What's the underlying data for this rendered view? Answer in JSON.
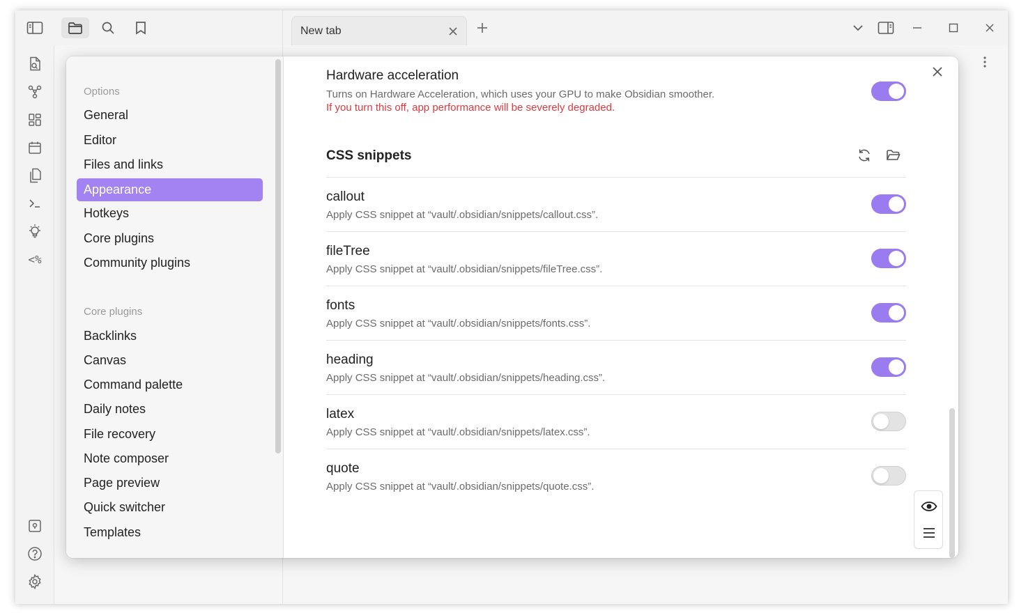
{
  "tab": {
    "title": "New tab"
  },
  "settings_nav": {
    "sections": [
      {
        "heading": "Options",
        "items": [
          "General",
          "Editor",
          "Files and links",
          "Appearance",
          "Hotkeys",
          "Core plugins",
          "Community plugins"
        ]
      },
      {
        "heading": "Core plugins",
        "items": [
          "Backlinks",
          "Canvas",
          "Command palette",
          "Daily notes",
          "File recovery",
          "Note composer",
          "Page preview",
          "Quick switcher",
          "Templates"
        ]
      }
    ],
    "active": "Appearance"
  },
  "hardware": {
    "title": "Hardware acceleration",
    "desc": "Turns on Hardware Acceleration, which uses your GPU to make Obsidian smoother.",
    "warning": "If you turn this off, app performance will be severely degraded.",
    "enabled": true
  },
  "css_snippets": {
    "title": "CSS snippets",
    "items": [
      {
        "name": "callout",
        "desc": "Apply CSS snippet at “vault/.obsidian/snippets/callout.css”.",
        "enabled": true
      },
      {
        "name": "fileTree",
        "desc": "Apply CSS snippet at “vault/.obsidian/snippets/fileTree.css”.",
        "enabled": true
      },
      {
        "name": "fonts",
        "desc": "Apply CSS snippet at “vault/.obsidian/snippets/fonts.css”.",
        "enabled": true
      },
      {
        "name": "heading",
        "desc": "Apply CSS snippet at “vault/.obsidian/snippets/heading.css”.",
        "enabled": true
      },
      {
        "name": "latex",
        "desc": "Apply CSS snippet at “vault/.obsidian/snippets/latex.css”.",
        "enabled": false
      },
      {
        "name": "quote",
        "desc": "Apply CSS snippet at “vault/.obsidian/snippets/quote.css”.",
        "enabled": false
      }
    ]
  },
  "colors": {
    "accent": "#a283f1",
    "toggle_on": "#9b7bf0",
    "warning": "#e0393e"
  }
}
